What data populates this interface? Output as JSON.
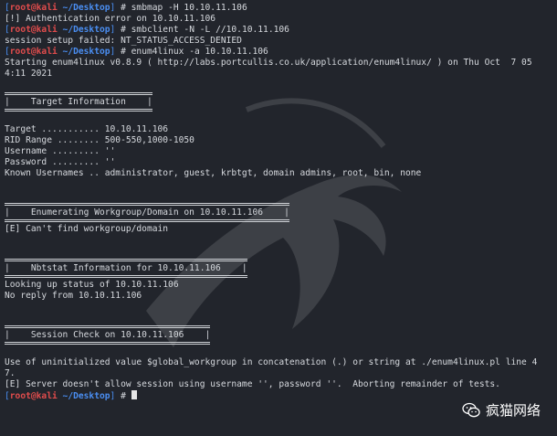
{
  "prompt": {
    "user": "root@kali",
    "path": "~/Desktop",
    "symbol": "#",
    "br_open": "[",
    "br_close": "]",
    "sep": " "
  },
  "lines": {
    "cmd1": "smbmap -H 10.10.11.106",
    "out1": "[!] Authentication error on 10.10.11.106",
    "cmd2": "smbclient -N -L //10.10.11.106",
    "out2": "session setup failed: NT_STATUS_ACCESS_DENIED",
    "cmd3": "enum4linux -a 10.10.11.106",
    "start1": "Starting enum4linux v0.8.9 ( http://labs.portcullis.co.uk/application/enum4linux/ ) on Thu Oct  7 05",
    "start2": "4:11 2021",
    "box1": "|    Target Information    |",
    "target": "Target ........... 10.10.11.106",
    "rid": "RID Range ........ 500-550,1000-1050",
    "username": "Username ......... ''",
    "password": "Password ......... ''",
    "known": "Known Usernames .. administrator, guest, krbtgt, domain admins, root, bin, none",
    "box2": "|    Enumerating Workgroup/Domain on 10.10.11.106    |",
    "err1": "[E] Can't find workgroup/domain",
    "box3": "|    Nbtstat Information for 10.10.11.106    |",
    "lookup": "Looking up status of 10.10.11.106",
    "noreply": "No reply from 10.10.11.106",
    "box4": "|    Session Check on 10.10.11.106    |",
    "uninit1": "Use of uninitialized value $global_workgroup in concatenation (.) or string at ./enum4linux.pl line 4",
    "uninit2": "7.",
    "err2": "[E] Server doesn't allow session using username '', password ''.  Aborting remainder of tests."
  },
  "watermark": {
    "text": "疯猫网络",
    "icon": "wechat-icon"
  }
}
